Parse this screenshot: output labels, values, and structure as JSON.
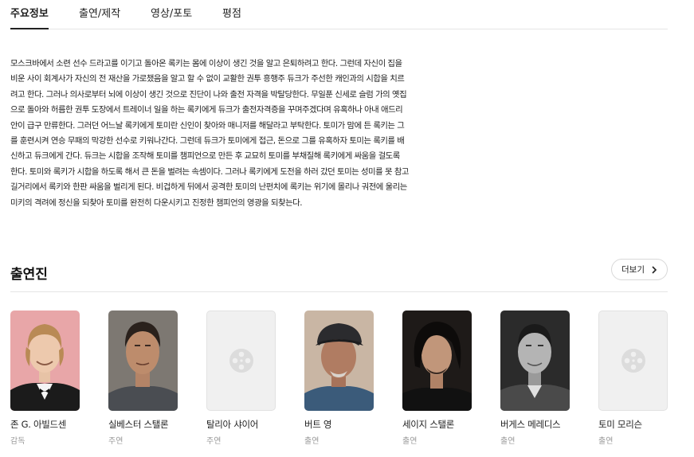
{
  "tabs": [
    {
      "label": "주요정보",
      "active": true
    },
    {
      "label": "출연/제작",
      "active": false
    },
    {
      "label": "영상/포토",
      "active": false
    },
    {
      "label": "평점",
      "active": false
    }
  ],
  "synopsis_lines": [
    "모스크바에서 소련 선수 드라고를 이기고 돌아온 록키는 몸에 이상이 생긴 것을 알고 은퇴하려고 한다. 그런데 자신이 집을",
    "비운 사이 회계사가 자신의 전 재산을 가로챘음을 알고 할 수 없이 교활한 권투 흥행주 듀크가 주선한 캐인과의 시합을 치르",
    "려고 한다. 그러나 의사로부터 뇌에 이상이 생긴 것으로 진단이 나와 출전 자격을 박탈당한다. 무일푼 신세로 슬럼 가의 옛집",
    "으로 돌아와 허름한 권투 도장에서 트레이너 일을 하는 록키에게 듀크가 출전자격증을 꾸며주겠다며 유혹하나 아내 애드리",
    "안이 급구 만류한다. 그러던 어느날 록키에게 토미란 신인이 찾아와 매니저를 해달라고 부탁한다. 토미가 맘에 든 록키는 그",
    "를 훈련시켜 연승 무패의 막강한 선수로 키워나간다. 그런데 듀크가 토미에게 접근, 돈으로 그를 유혹하자 토미는 록키를 배",
    "신하고 듀크에게 간다. 듀크는 시합을 조작해 토미를 챔피언으로 만든 후 교묘히 토미를 부채질해 록키에게 싸움을 걸도록",
    "한다. 토미와 록키가 시합을 하도록 해서 큰 돈을 벌려는 속셈이다. 그러나 록키에게 도전을 하러 갔던 토미는 성미를 못 참고",
    "길거리에서 록키와 한판 싸움을 벌리게 된다. 비겁하게 뒤에서 공격한 토미의 난펀치에 록키는 위기에 몰리나 궈전에 울리는",
    "미키의 격려에 정신을 되찾아 토미를 완전히 다운시키고 진정한 챔피언의 영광을 되찾는다."
  ],
  "cast_section": {
    "title": "출연진",
    "more_label": "더보기"
  },
  "cast": [
    {
      "name": "존 G. 아빌드센",
      "role": "감독",
      "photo": "director-portrait"
    },
    {
      "name": "실베스터 스탤론",
      "role": "주연",
      "photo": "actor-portrait"
    },
    {
      "name": "탈리아 샤이어",
      "role": "주연",
      "photo": "placeholder-film-icon"
    },
    {
      "name": "버트 영",
      "role": "출연",
      "photo": "actor-portrait"
    },
    {
      "name": "세이지 스탤론",
      "role": "출연",
      "photo": "actor-portrait"
    },
    {
      "name": "버게스 메레디스",
      "role": "출연",
      "photo": "actor-portrait-bw"
    },
    {
      "name": "토미 모리슨",
      "role": "출연",
      "photo": "placeholder-film-icon"
    }
  ],
  "colors": {
    "text": "#222222",
    "muted": "#999999",
    "divider": "#e5e5e5",
    "placeholder_bg": "#f0f0f0"
  }
}
